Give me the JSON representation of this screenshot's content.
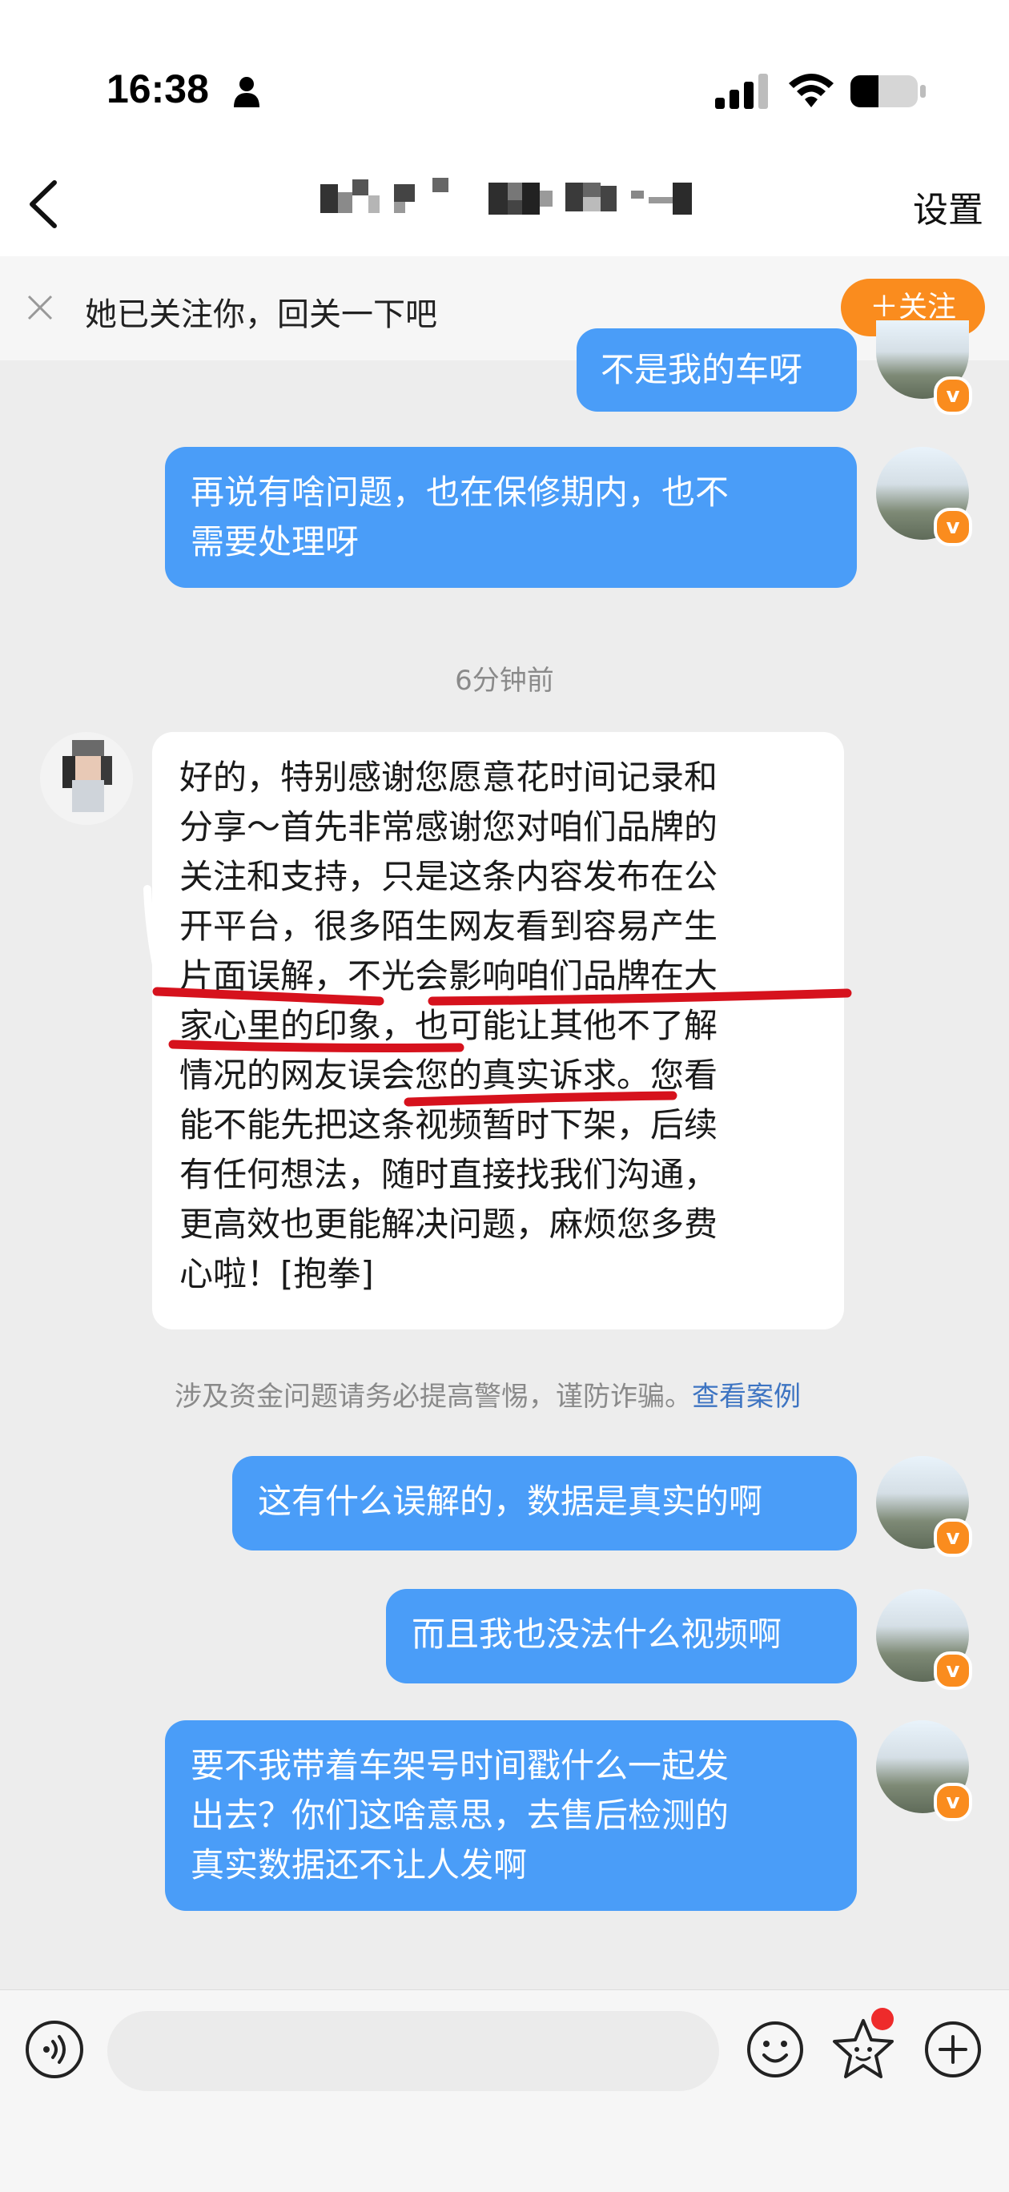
{
  "status_bar": {
    "time": "16:38"
  },
  "nav": {
    "back_icon": "chevron-left-icon",
    "settings_label": "设置"
  },
  "follow_banner": {
    "text": "她已关注你，回关一下吧",
    "follow_button": "＋关注"
  },
  "messages": [
    {
      "side": "out",
      "text": "不是我的车呀"
    },
    {
      "side": "out",
      "lines": [
        "再说有啥问题，也在保修期内，也不",
        "需要处理呀"
      ]
    },
    {
      "timestamp": "6分钟前"
    },
    {
      "side": "in",
      "lines": [
        "好的，特别感谢您愿意花时间记录和",
        "分享～首先非常感谢您对咱们品牌的",
        "关注和支持，只是这条内容发布在公",
        "开平台，很多陌生网友看到容易产生",
        "片面误解，不光会影响咱们品牌在大",
        "家心里的印象，也可能让其他不了解",
        "情况的网友误会您的真实诉求。您看",
        "能不能先把这条视频暂时下架，后续",
        "有任何想法，随时直接找我们沟通，",
        "更高效也更能解决问题，麻烦您多费",
        "心啦！[抱拳]"
      ]
    },
    {
      "side": "out",
      "text": "这有什么误解的，数据是真实的啊"
    },
    {
      "side": "out",
      "text": "而且我也没法什么视频啊"
    },
    {
      "side": "out",
      "lines": [
        "要不我带着车架号时间戳什么一起发",
        "出去？你们这啥意思，去售后检测的",
        "真实数据还不让人发啊"
      ]
    }
  ],
  "warning": {
    "text": "涉及资金问题请务必提高警惕，谨防诈骗。",
    "link": "查看案例"
  },
  "colors": {
    "outgoing_bubble": "#4a9df8",
    "follow_button": "#fa8c1e",
    "annotation_red": "#d6121d",
    "link": "#3d74c2"
  }
}
